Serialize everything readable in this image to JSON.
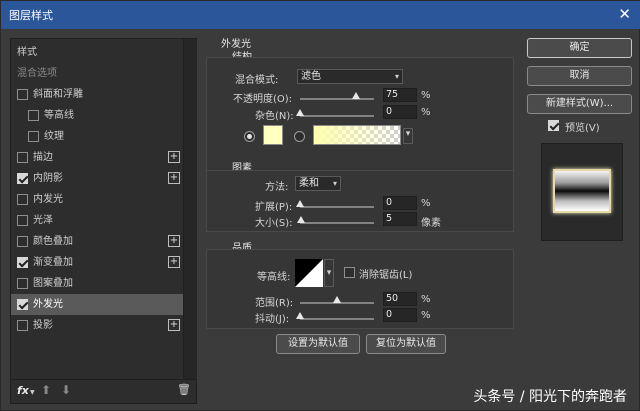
{
  "window": {
    "title": "图层样式",
    "close_glyph": "✕"
  },
  "left_panel": {
    "items": [
      {
        "label": "样式",
        "checkbox": false,
        "checked": false,
        "plus": false,
        "indent": 0,
        "dim": false
      },
      {
        "label": "混合选项",
        "checkbox": false,
        "checked": false,
        "plus": false,
        "indent": 0,
        "dim": true
      },
      {
        "label": "斜面和浮雕",
        "checkbox": true,
        "checked": false,
        "plus": false,
        "indent": 0,
        "dim": false
      },
      {
        "label": "等高线",
        "checkbox": true,
        "checked": false,
        "plus": false,
        "indent": 1,
        "dim": false
      },
      {
        "label": "纹理",
        "checkbox": true,
        "checked": false,
        "plus": false,
        "indent": 1,
        "dim": false
      },
      {
        "label": "描边",
        "checkbox": true,
        "checked": false,
        "plus": true,
        "indent": 0,
        "dim": false
      },
      {
        "label": "内阴影",
        "checkbox": true,
        "checked": true,
        "plus": true,
        "indent": 0,
        "dim": false
      },
      {
        "label": "内发光",
        "checkbox": true,
        "checked": false,
        "plus": false,
        "indent": 0,
        "dim": false
      },
      {
        "label": "光泽",
        "checkbox": true,
        "checked": false,
        "plus": false,
        "indent": 0,
        "dim": false
      },
      {
        "label": "颜色叠加",
        "checkbox": true,
        "checked": false,
        "plus": true,
        "indent": 0,
        "dim": false
      },
      {
        "label": "渐变叠加",
        "checkbox": true,
        "checked": true,
        "plus": true,
        "indent": 0,
        "dim": false
      },
      {
        "label": "图案叠加",
        "checkbox": true,
        "checked": false,
        "plus": false,
        "indent": 0,
        "dim": false
      },
      {
        "label": "外发光",
        "checkbox": true,
        "checked": true,
        "plus": false,
        "indent": 0,
        "dim": false,
        "selected": true
      },
      {
        "label": "投影",
        "checkbox": true,
        "checked": false,
        "plus": true,
        "indent": 0,
        "dim": false
      }
    ],
    "fx_label": "fx"
  },
  "outer_glow": {
    "title": "外发光",
    "structure": {
      "title": "结构",
      "blend_mode_label": "混合模式:",
      "blend_mode": "滤色",
      "opacity_label": "不透明度(O):",
      "opacity": "75",
      "opacity_unit": "%",
      "opacity_fraction": 0.75,
      "noise_label": "杂色(N):",
      "noise": "0",
      "noise_unit": "%",
      "noise_fraction": 0,
      "glow_color": "#ffffc0"
    },
    "elements": {
      "title": "图素",
      "method_label": "方法:",
      "method": "柔和",
      "spread_label": "扩展(P):",
      "spread": "0",
      "spread_unit": "%",
      "spread_fraction": 0,
      "size_label": "大小(S):",
      "size": "5",
      "size_unit": "像素",
      "size_fraction": 0.02
    },
    "quality": {
      "title": "品质",
      "contour_label": "等高线:",
      "antialias_label": "消除锯齿(L)",
      "range_label": "范围(R):",
      "range": "50",
      "range_unit": "%",
      "range_fraction": 0.5,
      "jitter_label": "抖动(J):",
      "jitter": "0",
      "jitter_unit": "%",
      "jitter_fraction": 0
    },
    "make_default": "设置为默认值",
    "reset_default": "复位为默认值"
  },
  "right": {
    "ok": "确定",
    "cancel": "取消",
    "new_style": "新建样式(W)...",
    "preview_label": "预览(V)",
    "preview_checked": true
  },
  "watermark": "头条号 / 阳光下的奔跑者"
}
